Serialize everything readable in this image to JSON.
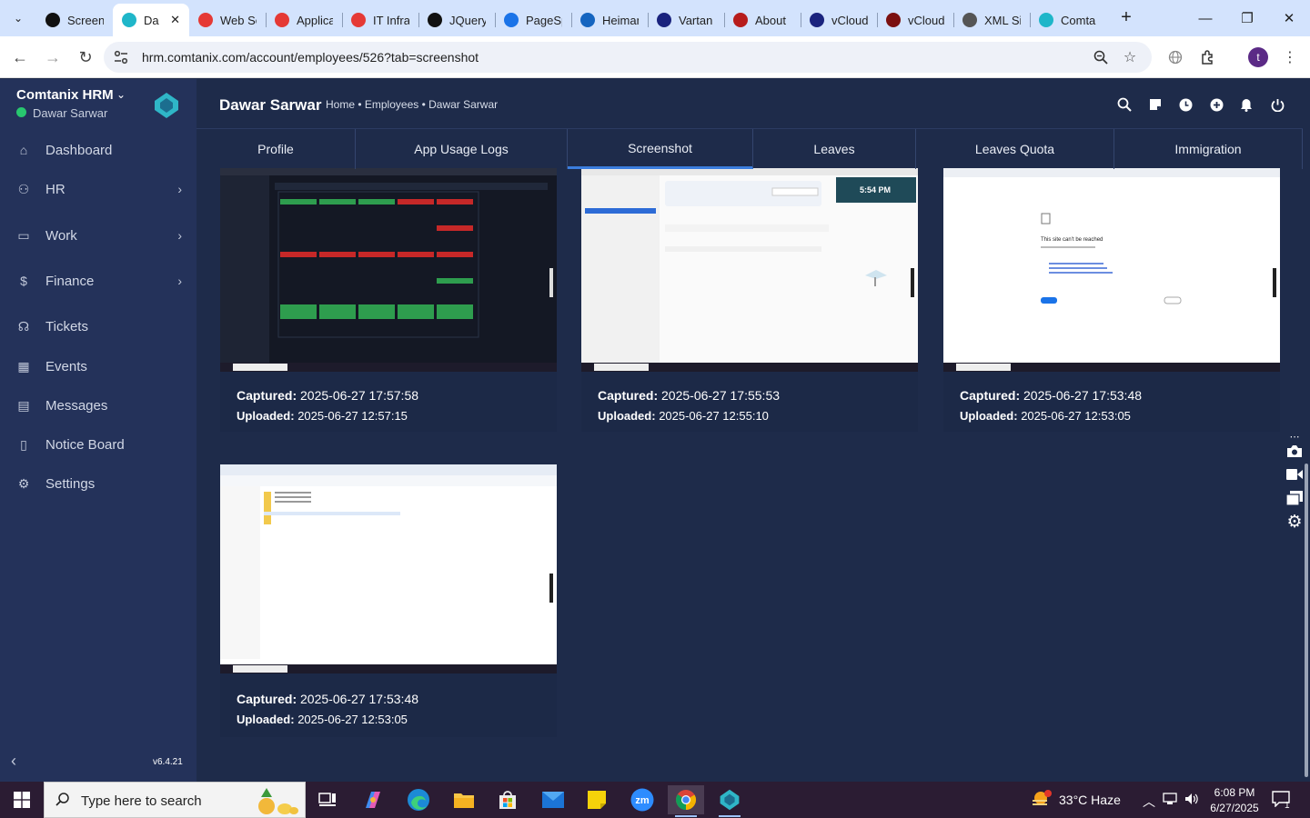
{
  "browser": {
    "tabs": [
      {
        "title": "Screen",
        "icon": "chatgpt-icon",
        "color": "#111111"
      },
      {
        "title": "Da",
        "icon": "comtanix-icon",
        "color": "#1fb6c9",
        "active": true
      },
      {
        "title": "Web Se",
        "icon": "diamond-icon",
        "color": "#e53935"
      },
      {
        "title": "Applica",
        "icon": "diamond-icon",
        "color": "#e53935"
      },
      {
        "title": "IT Infra",
        "icon": "diamond-icon",
        "color": "#e53935"
      },
      {
        "title": "JQuery",
        "icon": "github-icon",
        "color": "#111111"
      },
      {
        "title": "PageSp",
        "icon": "gauge-icon",
        "color": "#1a73e8"
      },
      {
        "title": "Heiman",
        "icon": "heiman-icon",
        "color": "#1565c0"
      },
      {
        "title": "Vartan",
        "icon": "x-icon",
        "color": "#1a237e"
      },
      {
        "title": "About",
        "icon": "about-icon",
        "color": "#b71c1c"
      },
      {
        "title": "vCloud",
        "icon": "v-check-icon",
        "color": "#1a237e"
      },
      {
        "title": "vCloud",
        "icon": "v-icon",
        "color": "#7b1010"
      },
      {
        "title": "XML Si",
        "icon": "globe-icon",
        "color": "#555555"
      },
      {
        "title": "Comta",
        "icon": "comtanix-icon",
        "color": "#1fb6c9"
      }
    ],
    "url": "hrm.comtanix.com/account/employees/526?tab=screenshot",
    "profile_initial": "t"
  },
  "app": {
    "brand": "Comtanix HRM",
    "user": "Dawar Sarwar",
    "version": "v6.4.21",
    "nav": [
      {
        "label": "Dashboard",
        "icon": "home-icon",
        "arrow": false
      },
      {
        "label": "HR",
        "icon": "users-icon",
        "arrow": true
      },
      {
        "label": "Work",
        "icon": "briefcase-icon",
        "arrow": true
      },
      {
        "label": "Finance",
        "icon": "dollar-icon",
        "arrow": true
      },
      {
        "label": "Tickets",
        "icon": "headset-icon",
        "arrow": false
      },
      {
        "label": "Events",
        "icon": "calendar-icon",
        "arrow": false
      },
      {
        "label": "Messages",
        "icon": "message-icon",
        "arrow": false
      },
      {
        "label": "Notice Board",
        "icon": "clipboard-icon",
        "arrow": false
      },
      {
        "label": "Settings",
        "icon": "gear-icon",
        "arrow": false
      }
    ]
  },
  "header": {
    "title": "Dawar Sarwar",
    "breadcrumb": "Home • Employees • Dawar Sarwar"
  },
  "profile_tabs": [
    {
      "label": "Profile"
    },
    {
      "label": "App Usage Logs"
    },
    {
      "label": "Screenshot",
      "active": true
    },
    {
      "label": "Leaves"
    },
    {
      "label": "Leaves Quota"
    },
    {
      "label": "Immigration"
    }
  ],
  "screenshots": [
    {
      "captured_label": "Captured:",
      "captured": "2025-06-27 17:57:58",
      "uploaded_label": "Uploaded:",
      "uploaded": "2025-06-27 12:57:15",
      "kind": "calendar-dark"
    },
    {
      "captured_label": "Captured:",
      "captured": "2025-06-27 17:55:53",
      "uploaded_label": "Uploaded:",
      "uploaded": "2025-06-27 12:55:10",
      "kind": "docs-light",
      "thumb_time": "5:54 PM"
    },
    {
      "captured_label": "Captured:",
      "captured": "2025-06-27 17:53:48",
      "uploaded_label": "Uploaded:",
      "uploaded": "2025-06-27 12:53:05",
      "kind": "error-page",
      "thumb_error": "This site can’t be reached"
    },
    {
      "captured_label": "Captured:",
      "captured": "2025-06-27 17:53:48",
      "uploaded_label": "Uploaded:",
      "uploaded": "2025-06-27 12:53:05",
      "kind": "explorer"
    }
  ],
  "taskbar": {
    "search_placeholder": "Type here to search",
    "weather": "33°C  Haze",
    "time": "6:08 PM",
    "date": "6/27/2025",
    "notifications": "1",
    "accent": "#2b1c33"
  }
}
